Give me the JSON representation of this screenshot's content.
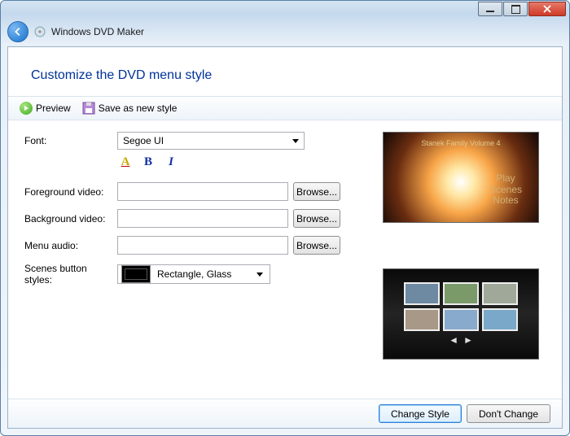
{
  "app_title": "Windows DVD Maker",
  "page_heading": "Customize the DVD menu style",
  "commands": {
    "preview": "Preview",
    "save_as_new_style": "Save as new style"
  },
  "form": {
    "font_label": "Font:",
    "font_value": "Segoe UI",
    "foreground_video_label": "Foreground video:",
    "foreground_video_value": "",
    "background_video_label": "Background video:",
    "background_video_value": "",
    "menu_audio_label": "Menu audio:",
    "menu_audio_value": "",
    "scenes_button_styles_label": "Scenes button styles:",
    "scenes_button_styles_value": "Rectangle, Glass",
    "browse_label": "Browse..."
  },
  "preview": {
    "dvd_title": "Stanek Family Volume 4",
    "dvd_link1": "Play",
    "dvd_link2": "Scenes",
    "dvd_link3": "Notes"
  },
  "footer": {
    "change_style": "Change Style",
    "dont_change": "Don't Change"
  }
}
